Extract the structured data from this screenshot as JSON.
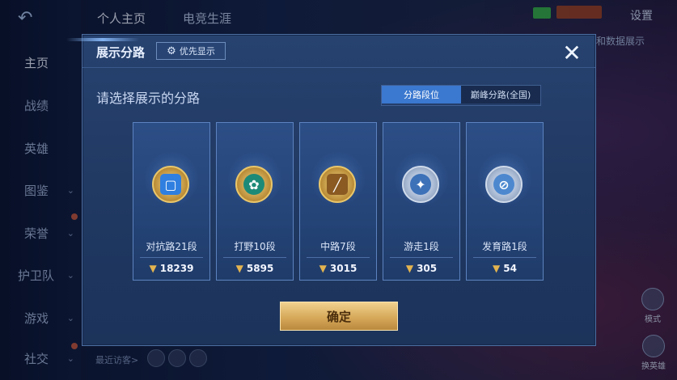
{
  "top_tabs": [
    "个人主页",
    "电竞生涯"
  ],
  "settings_label": "设置",
  "nav": [
    {
      "label": "主页"
    },
    {
      "label": "战绩"
    },
    {
      "label": "英雄"
    },
    {
      "label": "图鉴"
    },
    {
      "label": "荣誉"
    },
    {
      "label": "护卫队"
    },
    {
      "label": "游戏"
    },
    {
      "label": "社交"
    }
  ],
  "visitors_label": "最近访客>",
  "peek_text": "和数据展示",
  "corner_buttons": {
    "top": "模式",
    "bottom": "换英雄"
  },
  "modal": {
    "title": "展示分路",
    "priority_button": "优先显示",
    "prompt": "请选择展示的分路",
    "segments": [
      "分路段位",
      "巅峰分路(全国)"
    ],
    "confirm": "确定",
    "cards": [
      {
        "label": "对抗路21段",
        "score": "18239",
        "emblem": "clash-lane-emblem-icon"
      },
      {
        "label": "打野10段",
        "score": "5895",
        "emblem": "jungle-emblem-icon"
      },
      {
        "label": "中路7段",
        "score": "3015",
        "emblem": "mid-lane-emblem-icon"
      },
      {
        "label": "游走1段",
        "score": "305",
        "emblem": "roam-emblem-icon"
      },
      {
        "label": "发育路1段",
        "score": "54",
        "emblem": "farm-lane-emblem-icon"
      }
    ]
  },
  "colors": {
    "accent_blue": "#3b78cf",
    "gold": "#d7a95a",
    "modal_bg": "#27426f"
  }
}
